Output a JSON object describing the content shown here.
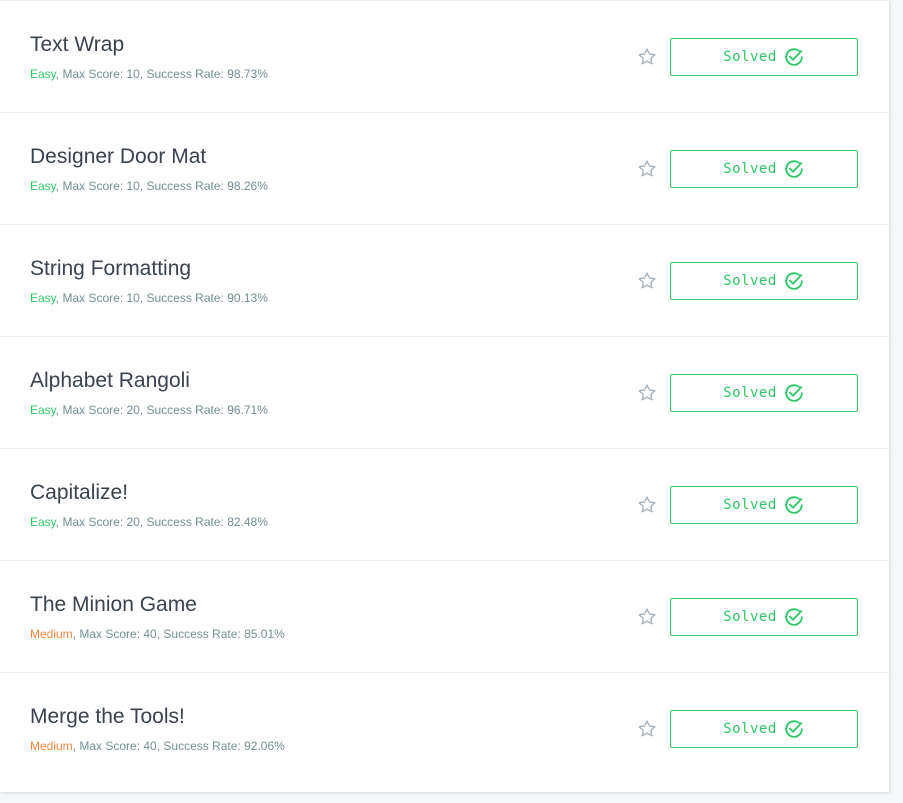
{
  "challenges": [
    {
      "title": "Text Wrap",
      "difficulty": "Easy",
      "difficulty_level": "easy",
      "max_score_text": ", Max Score: 10, Success Rate: 98.73%",
      "status": "Solved",
      "starred": false
    },
    {
      "title": "Designer Door Mat",
      "difficulty": "Easy",
      "difficulty_level": "easy",
      "max_score_text": ", Max Score: 10, Success Rate: 98.26%",
      "status": "Solved",
      "starred": false
    },
    {
      "title": "String Formatting",
      "difficulty": "Easy",
      "difficulty_level": "easy",
      "max_score_text": ", Max Score: 10, Success Rate: 90.13%",
      "status": "Solved",
      "starred": false
    },
    {
      "title": "Alphabet Rangoli",
      "difficulty": "Easy",
      "difficulty_level": "easy",
      "max_score_text": ", Max Score: 20, Success Rate: 96.71%",
      "status": "Solved",
      "starred": false
    },
    {
      "title": "Capitalize!",
      "difficulty": "Easy",
      "difficulty_level": "easy",
      "max_score_text": ", Max Score: 20, Success Rate: 82.48%",
      "status": "Solved",
      "starred": false
    },
    {
      "title": "The Minion Game",
      "difficulty": "Medium",
      "difficulty_level": "medium",
      "max_score_text": ", Max Score: 40, Success Rate: 85.01%",
      "status": "Solved",
      "starred": false
    },
    {
      "title": "Merge the Tools!",
      "difficulty": "Medium",
      "difficulty_level": "medium",
      "max_score_text": ", Max Score: 40, Success Rate: 92.06%",
      "status": "Solved",
      "starred": false
    }
  ],
  "colors": {
    "easy": "#2ec866",
    "medium": "#f5853f",
    "solved_accent": "#2ec866",
    "star_outline": "#a3aeb6"
  },
  "icons": {
    "star": "star-outline-icon",
    "check": "check-circle-icon"
  }
}
